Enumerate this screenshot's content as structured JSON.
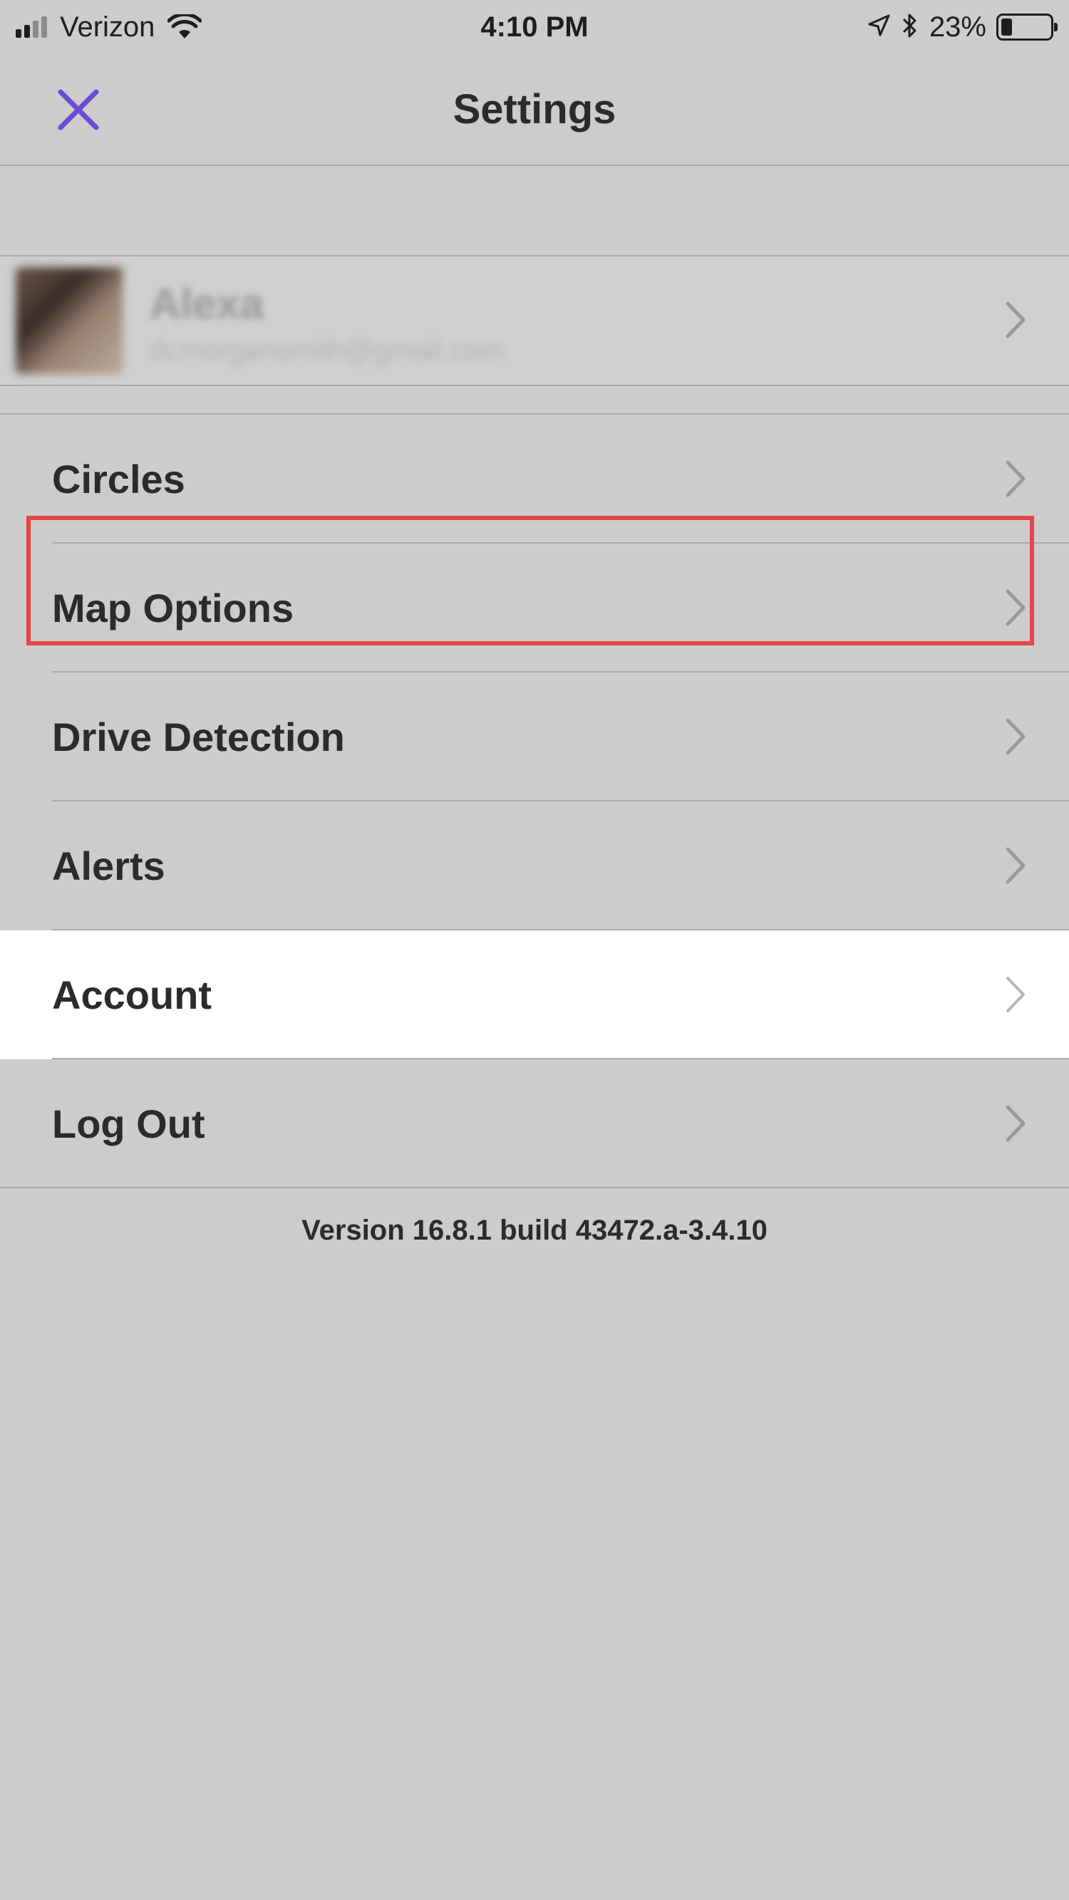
{
  "status_bar": {
    "carrier": "Verizon",
    "time": "4:10 PM",
    "battery_percent": "23%",
    "battery_level": 0.23,
    "signal_bars_filled": 2,
    "signal_bars_total": 4,
    "icons": [
      "signal-icon",
      "wifi-icon",
      "location-arrow-icon",
      "bluetooth-icon",
      "battery-icon"
    ]
  },
  "header": {
    "title": "Settings",
    "close_icon": "close-icon",
    "accent_color": "#6a4bd6"
  },
  "profile": {
    "name": "Alexa",
    "email": "dcmorgansmith@gmail.com",
    "chevron_icon": "chevron-right-icon"
  },
  "menu": {
    "items": [
      {
        "label": "Circles"
      },
      {
        "label": "Map Options"
      },
      {
        "label": "Drive Detection"
      },
      {
        "label": "Alerts"
      },
      {
        "label": "Account",
        "highlighted": true
      },
      {
        "label": "Log Out"
      }
    ],
    "highlight_color": "#e8454b"
  },
  "footer": {
    "version": "Version 16.8.1 build 43472.a-3.4.10"
  }
}
